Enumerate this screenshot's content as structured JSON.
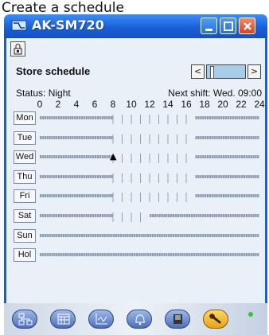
{
  "caption": "Create a schedule",
  "window": {
    "title": "AK-SM720"
  },
  "panel": {
    "subtitle": "Store schedule",
    "nav_prev": "<",
    "nav_next": ">",
    "status": "Status: Night",
    "next_shift": "Next shift: Wed. 09:00"
  },
  "hours": [
    "0",
    "2",
    "4",
    "6",
    "8",
    "10",
    "12",
    "14",
    "16",
    "18",
    "20",
    "22",
    "24"
  ],
  "days": [
    {
      "label": "Mon",
      "open": [
        [
          8,
          17
        ]
      ],
      "marker": null
    },
    {
      "label": "Tue",
      "open": [
        [
          8,
          17
        ]
      ],
      "marker": null
    },
    {
      "label": "Wed",
      "open": [
        [
          8,
          17
        ]
      ],
      "marker": 8
    },
    {
      "label": "Thu",
      "open": [
        [
          8,
          17
        ]
      ],
      "marker": null
    },
    {
      "label": "Fri",
      "open": [
        [
          8,
          17
        ]
      ],
      "marker": null
    },
    {
      "label": "Sat",
      "open": [
        [
          8,
          12
        ]
      ],
      "marker": null
    },
    {
      "label": "Sun",
      "open": [],
      "marker": null
    },
    {
      "label": "Hol",
      "open": [],
      "marker": null
    }
  ],
  "footer_icons": [
    "network-icon",
    "calendar-icon",
    "chart-icon",
    "bell-icon",
    "book-icon",
    "wrench-icon"
  ],
  "colors": {
    "title_blue": "#1a5fd8",
    "panel_bg": "#eaf0f8",
    "led_green": "#36c23a"
  }
}
